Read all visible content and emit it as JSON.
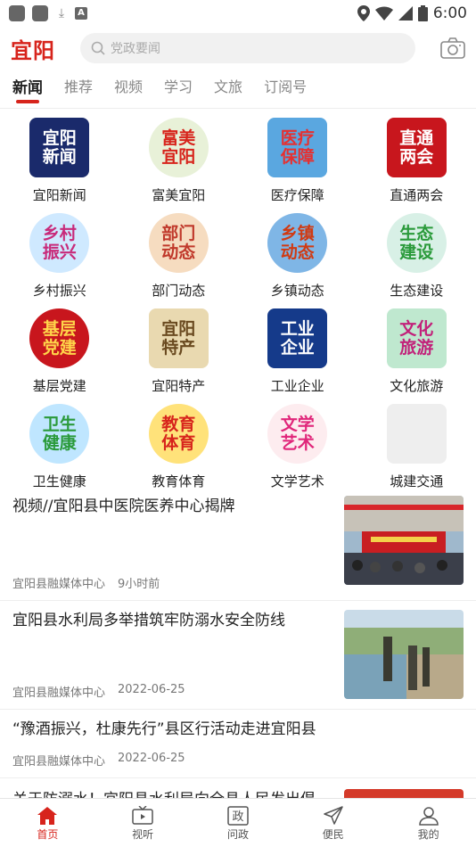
{
  "status": {
    "time": "6:00"
  },
  "header": {
    "logo": "宜阳",
    "search_placeholder": "党政要闻"
  },
  "tabs": [
    {
      "label": "新闻",
      "active": true
    },
    {
      "label": "推荐"
    },
    {
      "label": "视频"
    },
    {
      "label": "学习"
    },
    {
      "label": "文旅"
    },
    {
      "label": "订阅号"
    }
  ],
  "grid": [
    {
      "label": "宜阳新闻",
      "icon_text": "宜阳新闻",
      "bg": "#1a2a6b",
      "color": "#fff",
      "round": false
    },
    {
      "label": "富美宜阳",
      "icon_text": "富美宜阳",
      "bg": "#e8f1d8",
      "color": "#d7241c",
      "round": true
    },
    {
      "label": "医疗保障",
      "icon_text": "医疗保障",
      "bg": "#5aa7e0",
      "color": "#e63030",
      "round": false
    },
    {
      "label": "直通两会",
      "icon_text": "直通两会",
      "bg": "#c8161d",
      "color": "#fff",
      "round": false
    },
    {
      "label": "乡村振兴",
      "icon_text": "乡村振兴",
      "bg": "#cfe9ff",
      "color": "#c82a7a",
      "round": true
    },
    {
      "label": "部门动态",
      "icon_text": "部门动态",
      "bg": "#f6dcc0",
      "color": "#c0392b",
      "round": true
    },
    {
      "label": "乡镇动态",
      "icon_text": "乡镇动态",
      "bg": "#7fb6e6",
      "color": "#d03a12",
      "round": true
    },
    {
      "label": "生态建设",
      "icon_text": "生态建设",
      "bg": "#d8f0e6",
      "color": "#2a9a3a",
      "round": true
    },
    {
      "label": "基层党建",
      "icon_text": "基层党建",
      "bg": "#c8161d",
      "color": "#ffd54a",
      "round": true
    },
    {
      "label": "宜阳特产",
      "icon_text": "宜阳特产",
      "bg": "#e9d9b0",
      "color": "#6a4a20",
      "round": false
    },
    {
      "label": "工业企业",
      "icon_text": "工业企业",
      "bg": "#153a8a",
      "color": "#fff",
      "round": false
    },
    {
      "label": "文化旅游",
      "icon_text": "文化旅游",
      "bg": "#bfe8cf",
      "color": "#c2217a",
      "round": false
    },
    {
      "label": "卫生健康",
      "icon_text": "卫生健康",
      "bg": "#bfe6ff",
      "color": "#2a9a3a",
      "round": true
    },
    {
      "label": "教育体育",
      "icon_text": "教育体育",
      "bg": "#ffe27a",
      "color": "#d7241c",
      "round": true
    },
    {
      "label": "文学艺术",
      "icon_text": "文学艺术",
      "bg": "#fdecef",
      "color": "#e0267a",
      "round": true
    },
    {
      "label": "城建交通",
      "icon_text": "",
      "bg": "#eeeeee",
      "color": "#999",
      "round": false
    }
  ],
  "news": [
    {
      "title": "视频//宜阳县中医院医养中心揭牌",
      "source": "宜阳县融媒体中心",
      "time": "9小时前",
      "thumb": "ceremony"
    },
    {
      "title": "宜阳县水利局多举措筑牢防溺水安全防线",
      "source": "宜阳县融媒体中心",
      "time": "2022-06-25",
      "thumb": "river"
    },
    {
      "title": "“豫酒振兴，杜康先行”县区行活动走进宜阳县",
      "source": "宜阳县融媒体中心",
      "time": "2022-06-25",
      "thumb": ""
    },
    {
      "title": "关于防溺水！宜阳县水利局向全县人民发出倡",
      "source": "",
      "time": "",
      "thumb": "red"
    }
  ],
  "bottom_nav": [
    {
      "label": "首页",
      "icon": "home-icon",
      "active": true
    },
    {
      "label": "视听",
      "icon": "tv-icon"
    },
    {
      "label": "问政",
      "icon": "politics-icon"
    },
    {
      "label": "便民",
      "icon": "send-icon"
    },
    {
      "label": "我的",
      "icon": "user-icon"
    }
  ],
  "colors": {
    "accent": "#d7241c"
  }
}
